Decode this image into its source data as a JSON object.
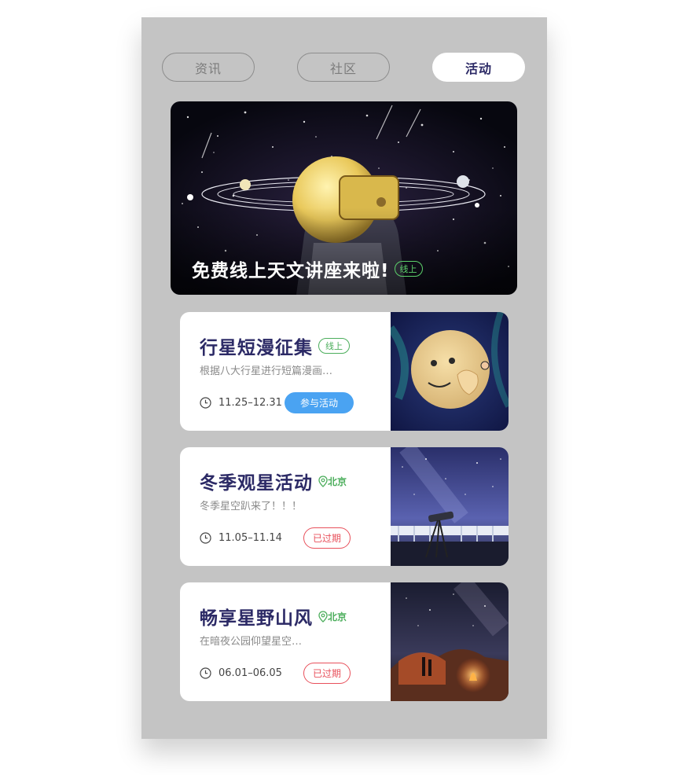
{
  "tabs": [
    {
      "label": "资讯",
      "active": false
    },
    {
      "label": "社区",
      "active": false
    },
    {
      "label": "活动",
      "active": true
    }
  ],
  "banner": {
    "title": "免费线上天文讲座来啦!",
    "tag": "线上"
  },
  "events": [
    {
      "title": "行星短漫征集",
      "tag": "线上",
      "description": "根据八大行星进行短篇漫画…",
      "date": "11.25–12.31",
      "action_label": "参与活动"
    },
    {
      "title": "冬季观星活动",
      "location": "北京",
      "description": "冬季星空趴来了！！！",
      "date": "11.05–11.14",
      "status": "已过期"
    },
    {
      "title": "畅享星野山风",
      "location": "北京",
      "description": "在暗夜公园仰望星空…",
      "date": "06.01–06.05",
      "status": "已过期"
    }
  ],
  "colors": {
    "background": "#c4c4c4",
    "title": "#2c2a66",
    "online_green": "#4cae5c",
    "join_blue": "#4aa3f2",
    "expired_red": "#e8505b"
  },
  "icons": [
    "clock-icon",
    "location-pin-icon"
  ]
}
